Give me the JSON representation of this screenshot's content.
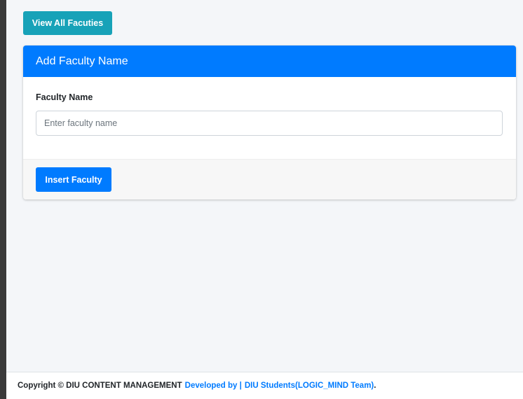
{
  "toolbar": {
    "view_all_label": "View All Facuties"
  },
  "card": {
    "title": "Add Faculty Name",
    "field_label": "Faculty Name",
    "input_placeholder": "Enter faculty name",
    "input_value": "",
    "submit_label": "Insert Faculty"
  },
  "footer": {
    "copyright": "Copyright © DIU CONTENT MANAGEMENT",
    "developed_by": "Developed by |",
    "team_link": "DIU Students(LOGIC_MIND Team)",
    "trailing_period": "."
  },
  "colors": {
    "primary": "#007bff",
    "info": "#17a2b8",
    "background": "#f4f6f9"
  }
}
